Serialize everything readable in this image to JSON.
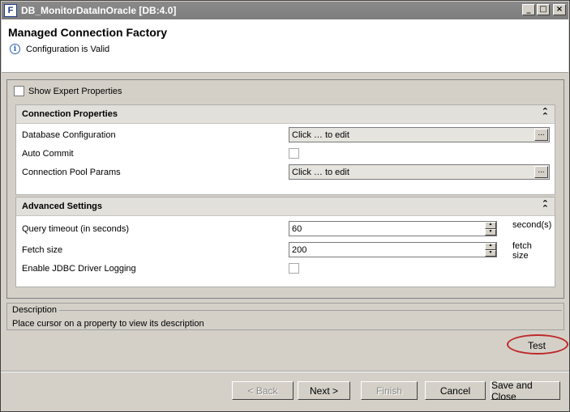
{
  "window": {
    "title": "DB_MonitorDataInOracle [DB:4.0]",
    "icon_letter": "F"
  },
  "title_buttons": {
    "minimize": "_",
    "maximize": "□",
    "close": "×"
  },
  "header": {
    "title": "Managed Connection Factory",
    "status": "Configuration is Valid",
    "status_icon": "info-icon"
  },
  "expert": {
    "label": "Show Expert Properties",
    "checked": false
  },
  "connection": {
    "title": "Connection Properties",
    "db_config": {
      "label": "Database Configuration",
      "value": "Click … to edit",
      "button": "..."
    },
    "auto_commit": {
      "label": "Auto Commit",
      "checked": false
    },
    "pool": {
      "label": "Connection Pool Params",
      "value": "Click … to edit",
      "button": "..."
    }
  },
  "advanced": {
    "title": "Advanced Settings",
    "query_timeout": {
      "label": "Query timeout (in seconds)",
      "value": "60",
      "unit": "second(s)"
    },
    "fetch_size": {
      "label": "Fetch size",
      "value": "200",
      "unit": "fetch size"
    },
    "jdbc_logging": {
      "label": "Enable JDBC Driver Logging",
      "checked": false
    }
  },
  "description": {
    "title": "Description",
    "text": "Place cursor on a property to view its description"
  },
  "buttons": {
    "test": "Test",
    "back": "< Back",
    "next": "Next >",
    "finish": "Finish",
    "cancel": "Cancel",
    "save_close": "Save and Close"
  },
  "colors": {
    "highlight_oval": "#c0282a",
    "title_bar": "#808080"
  }
}
